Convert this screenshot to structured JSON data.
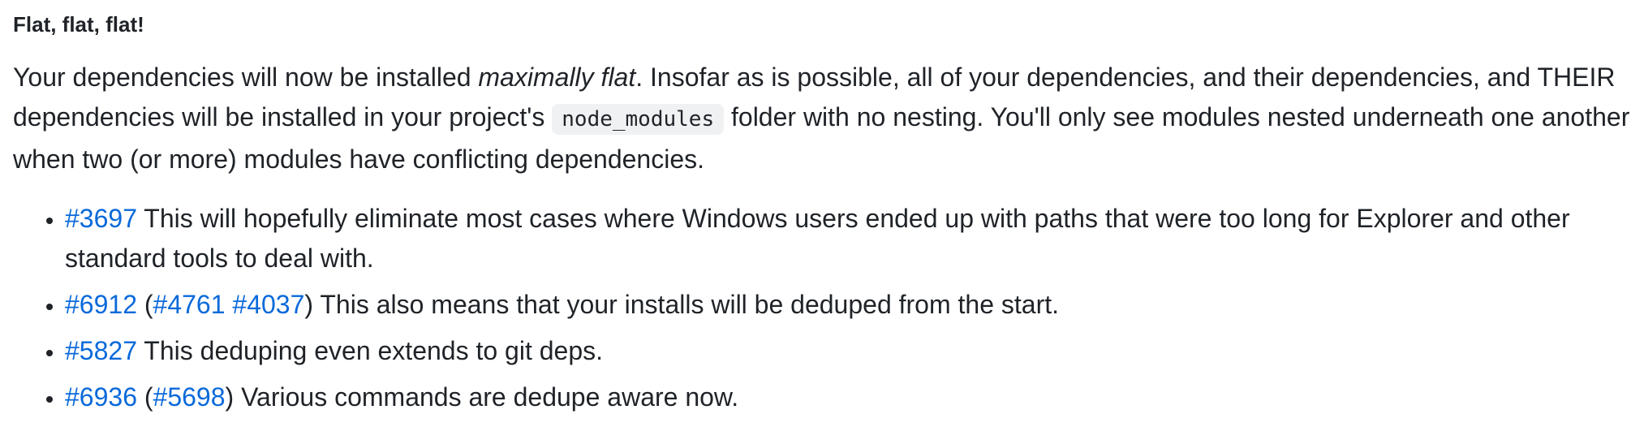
{
  "heading": "Flat, flat, flat!",
  "paragraph": {
    "part1": "Your dependencies will now be installed ",
    "emphasis": "maximally flat",
    "part2": ". Insofar as is possible, all of your dependencies, and their dependencies, and THEIR dependencies will be installed in your project's ",
    "code": "node_modules",
    "part3": " folder with no nesting. You'll only see modules nested underneath one another when two (or more) modules have conflicting dependencies."
  },
  "bullets": [
    {
      "link": "#3697",
      "text": " This will hopefully eliminate most cases where Windows users ended up with paths that were too long for Explorer and other standard tools to deal with."
    },
    {
      "link": "#6912",
      "paren_open": " (",
      "sublink1": "#4761",
      "space": " ",
      "sublink2": "#4037",
      "text": ") This also means that your installs will be deduped from the start."
    },
    {
      "link": "#5827",
      "text": " This deduping even extends to git deps."
    },
    {
      "link": "#6936",
      "paren_open": " (",
      "sublink1": "#5698",
      "text": ") Various commands are dedupe aware now."
    }
  ],
  "colors": {
    "link": "#0969da",
    "text": "#1f2328",
    "code_bg": "#eff1f3"
  }
}
